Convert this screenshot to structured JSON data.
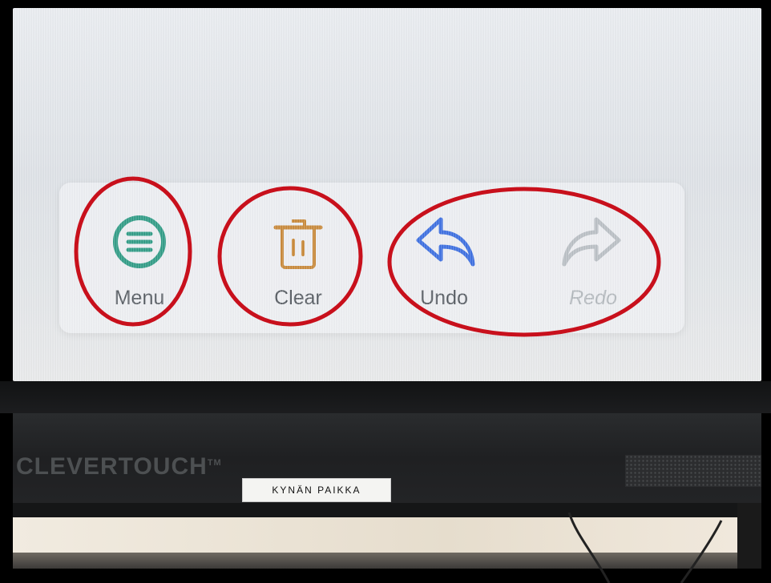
{
  "toolbar": {
    "menu_label": "Menu",
    "clear_label": "Clear",
    "undo_label": "Undo",
    "redo_label": "Redo"
  },
  "icons": {
    "menu": "hamburger-circle-icon",
    "clear": "trash-icon",
    "undo": "undo-arrow-icon",
    "redo": "redo-arrow-icon"
  },
  "colors": {
    "menu": "#2e9b85",
    "clear": "#c88838",
    "undo": "#3b6ee0",
    "redo": "#b9bec4",
    "annotation": "#c8101c"
  },
  "hardware": {
    "brand": "CLEVERTOUCH",
    "trademark": "TM",
    "pen_label": "KYNÄN PAIKKA"
  }
}
